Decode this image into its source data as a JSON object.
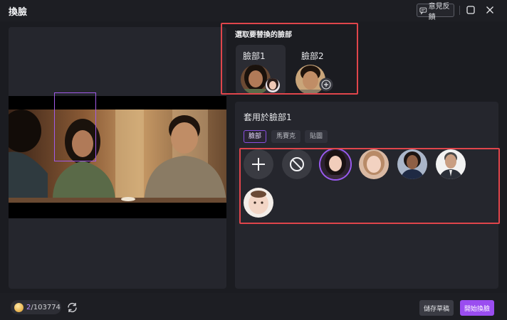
{
  "window": {
    "title": "換臉",
    "feedback_label": "意見反饋"
  },
  "select_faces": {
    "title": "選取要替換的臉部",
    "faces": [
      {
        "label": "臉部1",
        "active": true
      },
      {
        "label": "臉部2",
        "active": false
      }
    ]
  },
  "apply": {
    "title": "套用於臉部1",
    "tabs": [
      {
        "label": "臉部",
        "active": true
      },
      {
        "label": "馬賽克",
        "active": false
      },
      {
        "label": "貼圖",
        "active": false
      }
    ],
    "options": [
      {
        "name": "add",
        "icon": "plus-icon"
      },
      {
        "name": "none",
        "icon": "no-entry-icon"
      },
      {
        "name": "template-woman-dark-hair",
        "selected": true
      },
      {
        "name": "template-woman-blonde"
      },
      {
        "name": "template-woman-business"
      },
      {
        "name": "template-man-suit"
      },
      {
        "name": "template-baby"
      }
    ]
  },
  "footer": {
    "credits_used": "2",
    "credits_total": "/103774",
    "save_draft_label": "儲存草稿",
    "start_label": "開始換臉"
  },
  "colors": {
    "accent": "#9a4df0",
    "highlight_red": "#e0454b",
    "panel": "#25262d"
  }
}
